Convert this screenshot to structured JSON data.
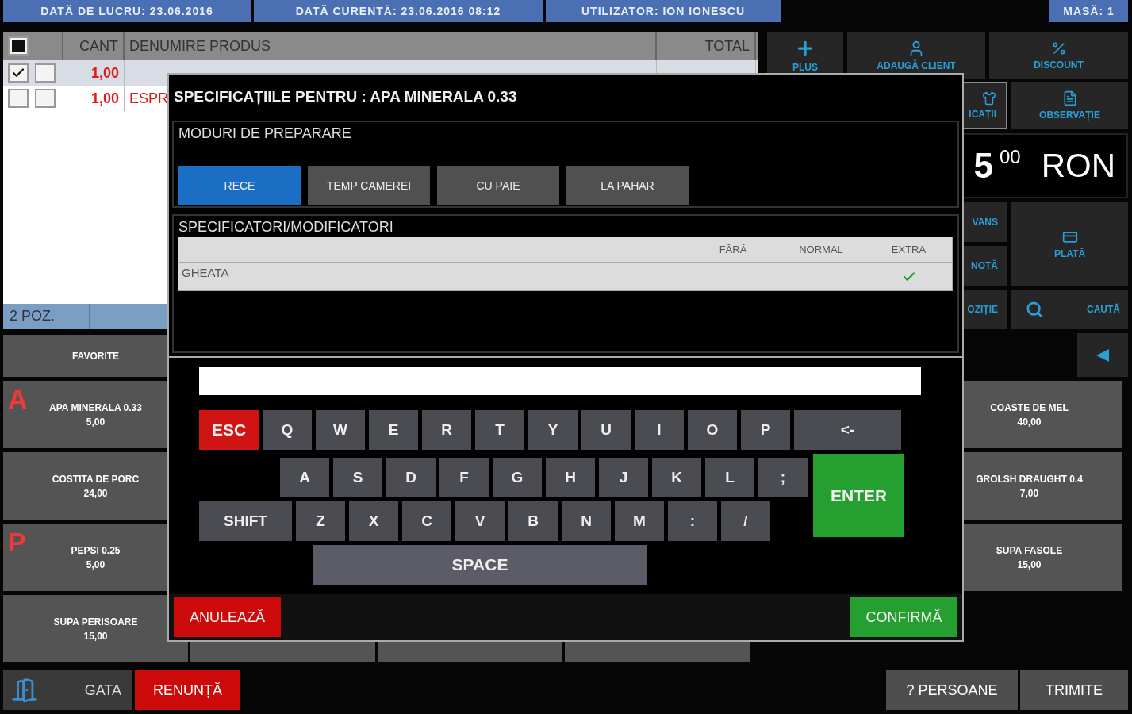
{
  "top_bar": {
    "items": [
      "DATĂ DE LUCRU: 23.06.2016",
      "DATĂ CURENTĂ: 23.06.2016 08:12",
      "UTILIZATOR: ION IONESCU"
    ],
    "table": "MASĂ: 1"
  },
  "order": {
    "columns": [
      "CANT",
      "DENUMIRE PRODUS",
      "TOTAL"
    ],
    "select_all_partial": true,
    "rows": [
      {
        "checked": true,
        "selected": true,
        "qty": "1,00"
      },
      {
        "checked": false,
        "selected": false,
        "qty": "1,00",
        "name": "ESPR"
      }
    ],
    "count": "2 POZ."
  },
  "actions": [
    "PLUS",
    "ADAUGĂ CLIENT",
    "DISCOUNT"
  ],
  "actions2": [
    "ICAȚII",
    "OBSERVAȚIE"
  ],
  "total": {
    "integer": "5",
    "decimals": "00",
    "currency": "RON"
  },
  "side_buttons": [
    "VANS",
    "NOTĂ",
    "OZIȚIE"
  ],
  "pay": "PLATĂ",
  "search": "CAUTĂ",
  "favorites": {
    "title": "FAVORITE",
    "items": [
      {
        "name": "APA MINERALA 0.33",
        "price": "5,00",
        "letter": "A"
      },
      {
        "name": "COSTITA DE PORC",
        "price": "24,00"
      },
      {
        "name": "PEPSI 0.25",
        "price": "5,00",
        "letter": "P"
      },
      {
        "name": "SUPA PERISOARE",
        "price": "15,00"
      }
    ]
  },
  "products_right": [
    {
      "name": "COASTE DE MEL",
      "price": "40,00"
    },
    {
      "name": "GROLSH DRAUGHT 0.4",
      "price": "7,00"
    },
    {
      "name": "SUPA FASOLE",
      "price": "15,00"
    }
  ],
  "footer": {
    "done": "GATA",
    "cancel": "RENUNȚĂ",
    "persons": "? PERSOANE",
    "send": "TRIMITE"
  },
  "modal": {
    "title": "SPECIFICAȚIILE PENTRU : APA MINERALA 0.33",
    "modes": {
      "title": "MODURI DE PREPARARE",
      "options": [
        {
          "label": "RECE",
          "selected": true
        },
        {
          "label": "TEMP CAMEREI",
          "selected": false
        },
        {
          "label": "CU PAIE",
          "selected": false
        },
        {
          "label": "LA PAHAR",
          "selected": false
        }
      ]
    },
    "modifiers": {
      "title": "SPECIFICATORI/MODIFICATORI",
      "columns": [
        "FĂRĂ",
        "NORMAL",
        "EXTRA"
      ],
      "rows": [
        {
          "name": "GHEATA",
          "cells": [
            {
              "checked": false
            },
            {
              "checked": false
            },
            {
              "checked": true
            }
          ]
        }
      ]
    },
    "keyboard": {
      "rows": [
        [
          {
            "label": "ESC",
            "kind": "esc"
          },
          {
            "label": "Q",
            "kind": "char"
          },
          {
            "label": "W",
            "kind": "char"
          },
          {
            "label": "E",
            "kind": "char"
          },
          {
            "label": "R",
            "kind": "char"
          },
          {
            "label": "T",
            "kind": "char"
          },
          {
            "label": "Y",
            "kind": "char"
          },
          {
            "label": "U",
            "kind": "char"
          },
          {
            "label": "I",
            "kind": "char"
          },
          {
            "label": "O",
            "kind": "char"
          },
          {
            "label": "P",
            "kind": "char"
          },
          {
            "label": "<-",
            "kind": "back"
          }
        ],
        [
          {
            "label": "A",
            "kind": "char"
          },
          {
            "label": "S",
            "kind": "char"
          },
          {
            "label": "D",
            "kind": "char"
          },
          {
            "label": "F",
            "kind": "char"
          },
          {
            "label": "G",
            "kind": "char"
          },
          {
            "label": "H",
            "kind": "char"
          },
          {
            "label": "J",
            "kind": "char"
          },
          {
            "label": "K",
            "kind": "char"
          },
          {
            "label": "L",
            "kind": "char"
          },
          {
            "label": ";",
            "kind": "char"
          }
        ],
        [
          {
            "label": "SHIFT",
            "kind": "shift"
          },
          {
            "label": "Z",
            "kind": "char"
          },
          {
            "label": "X",
            "kind": "char"
          },
          {
            "label": "C",
            "kind": "char"
          },
          {
            "label": "V",
            "kind": "char"
          },
          {
            "label": "B",
            "kind": "char"
          },
          {
            "label": "N",
            "kind": "char"
          },
          {
            "label": "M",
            "kind": "char"
          },
          {
            "label": ":",
            "kind": "char"
          },
          {
            "label": "/",
            "kind": "char"
          }
        ],
        [
          {
            "label": "SPACE",
            "kind": "space"
          }
        ]
      ],
      "enter": {
        "label": "ENTER",
        "kind": "enter"
      }
    },
    "cancel": "ANULEAZĂ",
    "confirm": "CONFIRMĂ"
  }
}
